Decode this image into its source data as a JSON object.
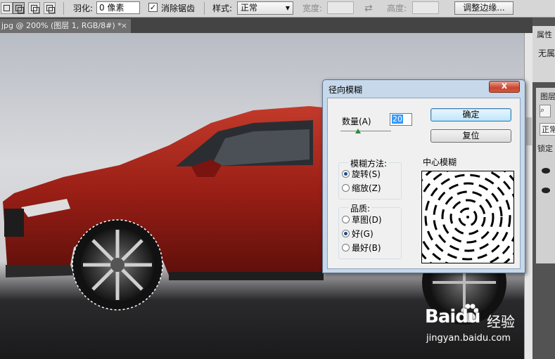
{
  "options_bar": {
    "feather_label": "羽化:",
    "feather_value": "0 像素",
    "antialias_label": "消除锯齿",
    "antialias_checked": "✓",
    "style_label": "样式:",
    "style_value": "正常",
    "width_label": "宽度:",
    "height_label": "高度:",
    "refine_edge_label": "调整边缘..."
  },
  "document_tab": {
    "title": "jpg @ 200% (图层 1, RGB/8#) *",
    "close": "×"
  },
  "right_panel": {
    "properties_label": "属性",
    "no_properties_label": "无属",
    "layers_label": "图层",
    "mode_label": "正常",
    "lock_label": "锁定"
  },
  "watermark": {
    "brand": "Baidu",
    "brand_cn": "经验",
    "url": "jingyan.baidu.com"
  },
  "dialog": {
    "title": "径向模糊",
    "close": "x",
    "amount_label": "数量(A)",
    "amount_value": "20",
    "amount_fraction": 0.2,
    "ok_label": "确定",
    "reset_label": "复位",
    "blur_method_label": "模糊方法:",
    "spin_label": "旋转(S)",
    "zoom_label": "缩放(Z)",
    "quality_label": "品质:",
    "draft_label": "草图(D)",
    "good_label": "好(G)",
    "best_label": "最好(B)",
    "center_label": "中心模糊",
    "selected_method": "旋转(S)",
    "selected_quality": "好(G)"
  }
}
